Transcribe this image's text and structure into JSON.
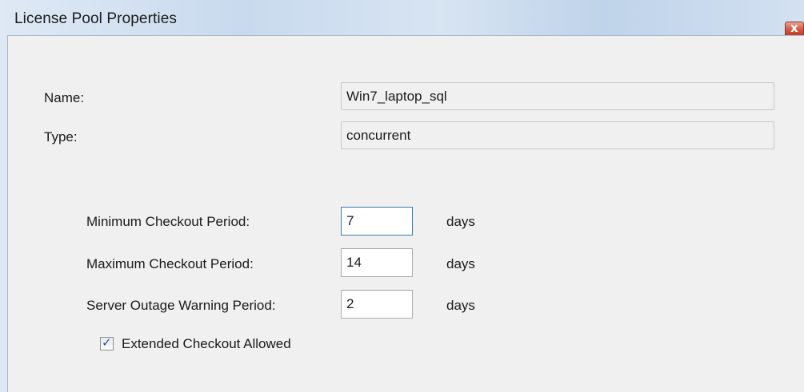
{
  "window": {
    "title": "License Pool Properties",
    "close_glyph": "x"
  },
  "fields": {
    "name_label": "Name:",
    "name_value": "Win7_laptop_sql",
    "type_label": "Type:",
    "type_value": "concurrent"
  },
  "periods": {
    "min_label": "Minimum Checkout Period:",
    "min_value": "7",
    "max_label": "Maximum Checkout Period:",
    "max_value": "14",
    "outage_label": "Server Outage Warning Period:",
    "outage_value": "2",
    "unit": "days"
  },
  "extended": {
    "label": "Extended Checkout Allowed",
    "checked": true,
    "check_glyph": "✓"
  }
}
